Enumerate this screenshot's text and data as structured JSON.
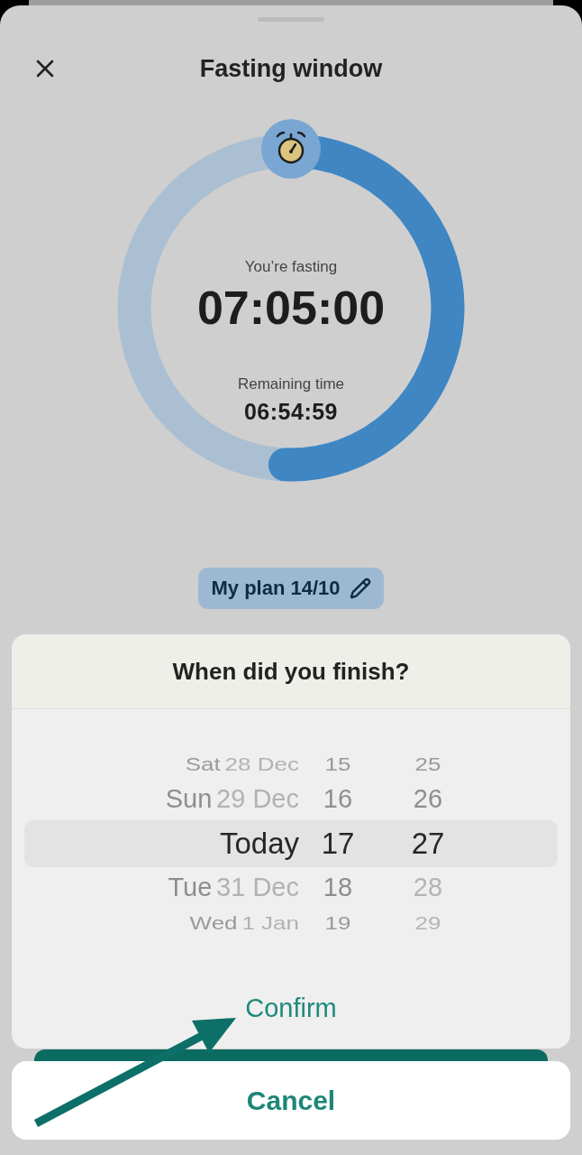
{
  "sheet": {
    "title": "Fasting window"
  },
  "timer": {
    "status": "You’re fasting",
    "elapsed": "07:05:00",
    "remaining_label": "Remaining time",
    "remaining": "06:54:59",
    "level": 0.506
  },
  "plan_button": {
    "label": "My plan 14/10"
  },
  "picker": {
    "title": "When did you finish?",
    "columns": [
      {
        "kind": "date",
        "items": [
          {
            "day": "Sat",
            "date": "28 Dec",
            "selected": false
          },
          {
            "day": "Sun",
            "date": "29 Dec",
            "selected": false
          },
          {
            "day": "Today",
            "selected": true
          },
          {
            "day": "Tue",
            "date": "31 Dec",
            "selected": false
          },
          {
            "day": "Wed",
            "date": "1 Jan",
            "selected": false
          }
        ]
      },
      {
        "kind": "hour",
        "items": [
          {
            "text": "15",
            "selected": false,
            "disabled": false
          },
          {
            "text": "16",
            "selected": false,
            "disabled": false
          },
          {
            "text": "17",
            "selected": true,
            "disabled": false
          },
          {
            "text": "18",
            "selected": false,
            "disabled": false
          },
          {
            "text": "19",
            "selected": false,
            "disabled": false
          }
        ]
      },
      {
        "kind": "minute",
        "items": [
          {
            "text": "25",
            "selected": false,
            "disabled": false
          },
          {
            "text": "26",
            "selected": false,
            "disabled": false
          },
          {
            "text": "27",
            "selected": true,
            "disabled": false
          },
          {
            "text": "28",
            "selected": false,
            "disabled": true
          },
          {
            "text": "29",
            "selected": false,
            "disabled": true
          }
        ]
      }
    ],
    "confirm": "Confirm"
  },
  "cancel": "Cancel"
}
